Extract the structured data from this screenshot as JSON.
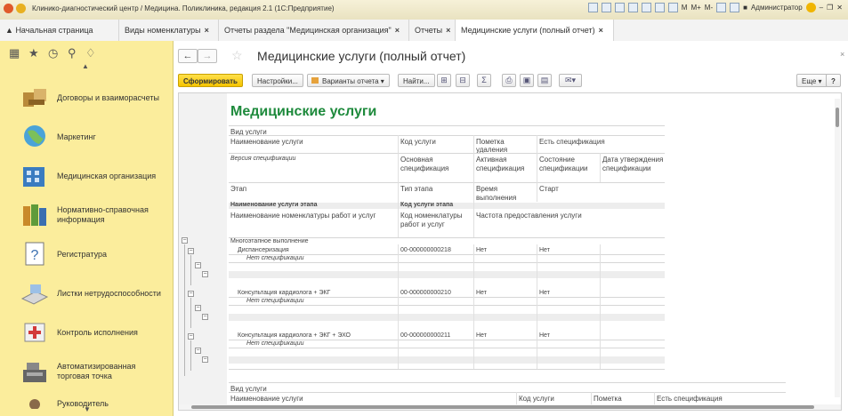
{
  "window": {
    "title": "Клинико-диагностический центр / Медицина. Поликлиника, редакция 2.1  (1С:Предприятие)",
    "controls": [
      "M",
      "M+",
      "M-"
    ],
    "user": "Администратор"
  },
  "tabs": [
    {
      "label": "Начальная страница",
      "closable": false
    },
    {
      "label": "Виды номенклатуры",
      "closable": true
    },
    {
      "label": "Отчеты раздела \"Медицинская организация\"",
      "closable": true
    },
    {
      "label": "Отчеты",
      "closable": true
    },
    {
      "label": "Медицинские услуги (полный отчет)",
      "closable": true
    }
  ],
  "sidebar": {
    "items": [
      {
        "label": "Договоры и взаиморасчеты",
        "icon": "handshake-icon"
      },
      {
        "label": "Маркетинг",
        "icon": "globe-icon"
      },
      {
        "label": "Медицинская организация",
        "icon": "building-icon"
      },
      {
        "label": "Нормативно-справочная информация",
        "icon": "books-icon"
      },
      {
        "label": "Регистратура",
        "icon": "question-card-icon"
      },
      {
        "label": "Листки нетрудоспособности",
        "icon": "sick-leave-icon"
      },
      {
        "label": "Контроль исполнения",
        "icon": "first-aid-icon"
      },
      {
        "label": "Автоматизированная торговая точка",
        "icon": "cash-register-icon"
      },
      {
        "label": "Руководитель",
        "icon": "manager-icon"
      }
    ]
  },
  "page": {
    "title": "Медицинские услуги (полный отчет)",
    "toolbar": {
      "generate": "Сформировать",
      "settings": "Настройки...",
      "variants": "Варианты отчета",
      "find": "Найти...",
      "more": "Еще",
      "help": "?"
    }
  },
  "report": {
    "title": "Медицинские услуги",
    "header": {
      "r1": {
        "c1": "Вид услуги"
      },
      "r2": {
        "c1": "Наименование услуги",
        "c2": "Код услуги",
        "c3": "Пометка удаления",
        "c4": "Есть спецификация"
      },
      "r3": {
        "c1": "Версия спецификации",
        "c2": "Основная спецификация",
        "c3": "Активная спецификация",
        "c4": "Состояние спецификации",
        "c5": "Дата утверждения спецификации"
      },
      "r4": {
        "c1": "Этап",
        "c2": "Тип этапа",
        "c3": "Время выполнения",
        "c4": "Старт"
      },
      "r5": {
        "c1": "Наименование услуги этапа",
        "c2": "Код услуги этапа"
      },
      "r6": {
        "c1": "Наименование номенклатуры работ и услуг",
        "c2": "Код номенклатуры работ и услуг",
        "c3": "Частота предоставления услуги"
      }
    },
    "group_label": "Многоэтапное выполнение",
    "rows": [
      {
        "name": "Диспансеризация",
        "code": "00-000000000218",
        "mark": "Нет",
        "spec": "Нет",
        "note": "Нет спецификации"
      },
      {
        "name": "Консультация кардиолога + ЭКГ",
        "code": "00-000000000210",
        "mark": "Нет",
        "spec": "Нет",
        "note": "Нет спецификации"
      },
      {
        "name": "Консультация кардиолога + ЭКГ + ЭХО",
        "code": "00-000000000211",
        "mark": "Нет",
        "spec": "Нет",
        "note": "Нет спецификации"
      }
    ],
    "footer": {
      "r1": {
        "c1": "Вид услуги"
      },
      "r2": {
        "c1": "Наименование услуги",
        "c2": "Код услуги",
        "c3": "Пометка",
        "c4": "Есть спецификация"
      }
    }
  },
  "colors": {
    "accent_button": "#f5c400",
    "sidebar_bg": "#fbed9c",
    "report_title": "#1e8a3c"
  }
}
